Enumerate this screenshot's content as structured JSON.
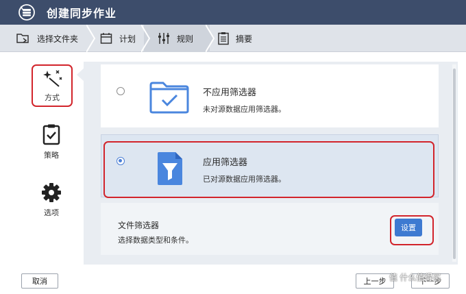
{
  "window": {
    "title": "创建同步作业"
  },
  "steps": [
    {
      "label": "选择文件夹",
      "icon": "folder-sync-icon"
    },
    {
      "label": "计划",
      "icon": "calendar-icon"
    },
    {
      "label": "规则",
      "icon": "sliders-icon"
    },
    {
      "label": "摘要",
      "icon": "clipboard-list-icon"
    }
  ],
  "nav": [
    {
      "label": "方式",
      "icon": "magic-wand-icon",
      "active": true
    },
    {
      "label": "策略",
      "icon": "clipboard-check-icon",
      "active": false
    },
    {
      "label": "选项",
      "icon": "gear-icon",
      "active": false
    }
  ],
  "options": [
    {
      "title": "不应用筛选器",
      "desc": "未对源数据应用筛选器。",
      "selected": false,
      "icon": "folder-check-icon"
    },
    {
      "title": "应用筛选器",
      "desc": "已对源数据应用筛选器。",
      "selected": true,
      "icon": "file-filter-icon"
    }
  ],
  "file_filter": {
    "title": "文件筛选器",
    "desc": "选择数据类型和条件。",
    "button": "设置"
  },
  "footer": {
    "cancel": "取消",
    "prev": "上一步",
    "next": "下一步"
  },
  "watermark": "值 什么值得买",
  "colors": {
    "titlebar": "#3d4d6b",
    "accent": "#3e7ad1",
    "highlight": "#d2232a",
    "selected_bg": "#dde6f1"
  }
}
